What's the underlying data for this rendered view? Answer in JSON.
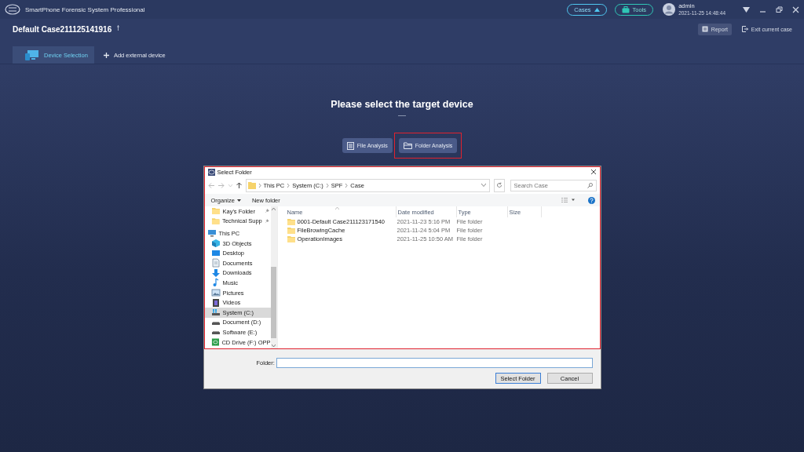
{
  "window": {
    "title": "SmartPhone Forensic System Professional"
  },
  "header_buttons": [
    {
      "label": "Cases",
      "kind": "cases"
    },
    {
      "label": "Tools",
      "kind": "tools"
    }
  ],
  "user": {
    "name": "admin",
    "datetime": "2021-11-25 14:48:44"
  },
  "case": {
    "title": "Default Case211125141916"
  },
  "case_actions": [
    {
      "label": "Report",
      "kind": "report"
    },
    {
      "label": "Exit current case",
      "kind": "exit"
    }
  ],
  "tabs": [
    {
      "label": "Device Selection",
      "selected": true,
      "kind": "device"
    },
    {
      "label": "Add external device",
      "selected": false,
      "kind": "add"
    }
  ],
  "heading": "Please select the target device",
  "analysis_buttons": [
    {
      "label": "File Analysis",
      "kind": "file",
      "highlighted": false
    },
    {
      "label": "Folder Analysis",
      "kind": "folder",
      "highlighted": true
    }
  ],
  "dialog": {
    "title": "Select Folder",
    "highlighted": true,
    "breadcrumb": [
      "This PC",
      "System (C:)",
      "SPF",
      "Case"
    ],
    "search": {
      "placeholder": "Search Case"
    },
    "toolbar": [
      "Organize",
      "New folder"
    ],
    "sidebar": [
      {
        "label": "Kay's Folder",
        "kind": "folder",
        "pinned": true,
        "selected": false
      },
      {
        "label": "Technical Supp",
        "kind": "folder",
        "pinned": true,
        "selected": false
      },
      {
        "label": "This PC",
        "kind": "pc",
        "pinned": false,
        "selected": false
      },
      {
        "label": "3D Objects",
        "kind": "cube",
        "pinned": false,
        "selected": false
      },
      {
        "label": "Desktop",
        "kind": "desktop",
        "pinned": false,
        "selected": false
      },
      {
        "label": "Documents",
        "kind": "document",
        "pinned": false,
        "selected": false
      },
      {
        "label": "Downloads",
        "kind": "download",
        "pinned": false,
        "selected": false
      },
      {
        "label": "Music",
        "kind": "music",
        "pinned": false,
        "selected": false
      },
      {
        "label": "Pictures",
        "kind": "picture",
        "pinned": false,
        "selected": false
      },
      {
        "label": "Videos",
        "kind": "video",
        "pinned": false,
        "selected": false
      },
      {
        "label": "System (C:)",
        "kind": "system",
        "pinned": false,
        "selected": true
      },
      {
        "label": "Document (D:)",
        "kind": "drive",
        "pinned": false,
        "selected": false
      },
      {
        "label": "Software (E:)",
        "kind": "drive",
        "pinned": false,
        "selected": false
      },
      {
        "label": "CD Drive (F:) OPP",
        "kind": "cd",
        "pinned": false,
        "selected": false
      }
    ],
    "columns": [
      "Name",
      "Date modified",
      "Type",
      "Size"
    ],
    "rows": [
      {
        "name": "0001-Default Case211123171540",
        "date": "2021-11-23 5:16 PM",
        "type": "File folder"
      },
      {
        "name": "FileBrowingCache",
        "date": "2021-11-24 5:04 PM",
        "type": "File folder"
      },
      {
        "name": "OperationImages",
        "date": "2021-11-25 10:50 AM",
        "type": "File folder"
      }
    ],
    "folder_label": "Folder:",
    "buttons": [
      {
        "label": "Select Folder",
        "kind": "default"
      },
      {
        "label": "Cancel",
        "kind": "normal"
      }
    ]
  }
}
